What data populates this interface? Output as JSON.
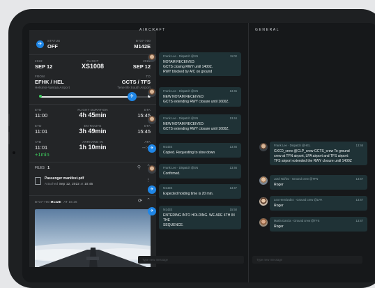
{
  "left": {
    "status_label": "STATUS",
    "status_value": "OFF",
    "aircraft_type": "B737-700",
    "aircraft_reg": "M142E",
    "dep_year": "2022",
    "dep_date": "SEP 12",
    "flight_label": "FLIGHT",
    "flight_value": "XS1008",
    "arr_year": "2022",
    "arr_date": "SEP 12",
    "from_label": "FROM",
    "from_code": "EFHK / HEL",
    "from_name": "Helsinki-Vantaa Airport",
    "to_label": "TO",
    "to_code": "GCTS / TFS",
    "to_name": "Tenerife South Airport",
    "etd_label": "ETD",
    "etd_value": "11:00",
    "duration_label": "FLIGHT DURATION",
    "duration_value": "4h 45min",
    "eta_label": "ETA",
    "eta_value": "15:45",
    "etd2_label": "ETD",
    "etd2_value": "11:01",
    "enroute_label": "EN-ROUTE",
    "enroute_value": "3h 49min",
    "eta2_label": "ETA",
    "eta2_value": "15:45",
    "atd_label": "ATD",
    "atd_value": "11:01",
    "atd_delay": "+1min",
    "arriving_label": "ARRIVING IN",
    "arriving_value": "1h 10min",
    "ata_label": "ATA",
    "ata_value": "--:--",
    "files_label": "FILES",
    "files_count": "1",
    "file_name": "Passenger manifest.pdf",
    "file_attached_prefix": "Attached",
    "file_attached_date": "Sep 12, 2022",
    "file_attached_at": "at",
    "file_attached_time": "10:45",
    "cam_aircraft_type": "B737-700",
    "cam_aircraft_reg": "M142E",
    "cam_time": "AT 16:26",
    "progress_fraction": 0.84
  },
  "aircraft": {
    "title": "AIRCRAFT",
    "input_placeholder": "Type new message",
    "messages": [
      {
        "sender": "Frank Lee · Dispatch @SN",
        "time": "11:02",
        "lines": [
          "NOTAM RECEIVED:",
          "GCTS closing RWY until 1400Z.",
          "RWY blocked by A/C on ground"
        ]
      },
      {
        "sender": "Frank Lee · Dispatch @SN",
        "time": "13:45",
        "lines": [
          "NEW NOTAM RECEIVED:",
          "GCTS extending RWY closure until 1600Z."
        ]
      },
      {
        "sender": "Frank Lee · Dispatch @SN",
        "time": "13:44",
        "lines": [
          "NEW NOTAM RECEIVED:",
          "GCTS extending RWY closure until 1600Z."
        ]
      },
      {
        "sender": "M142E",
        "time": "13:46",
        "lines": [
          "Copied. Requesting to slow down"
        ]
      },
      {
        "sender": "Frank Lee · Dispatch @SN",
        "time": "13:46",
        "lines": [
          "Confirmed."
        ]
      },
      {
        "sender": "M142E",
        "time": "13:47",
        "lines": [
          "Expected holding time is 20 min."
        ]
      },
      {
        "sender": "M142E",
        "time": "15:50",
        "lines": [
          "ENTERING INTO HOLDING. WE ARE 4TH IN THE",
          "SEQUENCE."
        ]
      }
    ]
  },
  "general": {
    "title": "GENERAL",
    "input_placeholder": "Type new message",
    "messages": [
      {
        "sender": "Frank Lee · Dispatch @HEL",
        "time": "13:46",
        "lines": [
          "GXC0_crew @CLP_crew GCTS_crew To ground",
          "crew at TFN airport, LPA airport and TFS airport:",
          "TFS airport extended the RWY closure until 1400Z"
        ]
      },
      {
        "sender": "José Núñez · Ground crew @TFN",
        "time": "13:47",
        "lines": [
          "Roger"
        ]
      },
      {
        "sender": "Leo Hernández · Ground crew @LPA",
        "time": "13:47",
        "lines": [
          "Roger"
        ]
      },
      {
        "sender": "María García · Ground crew @TFS",
        "time": "13:47",
        "lines": [
          "Roger"
        ]
      }
    ]
  }
}
